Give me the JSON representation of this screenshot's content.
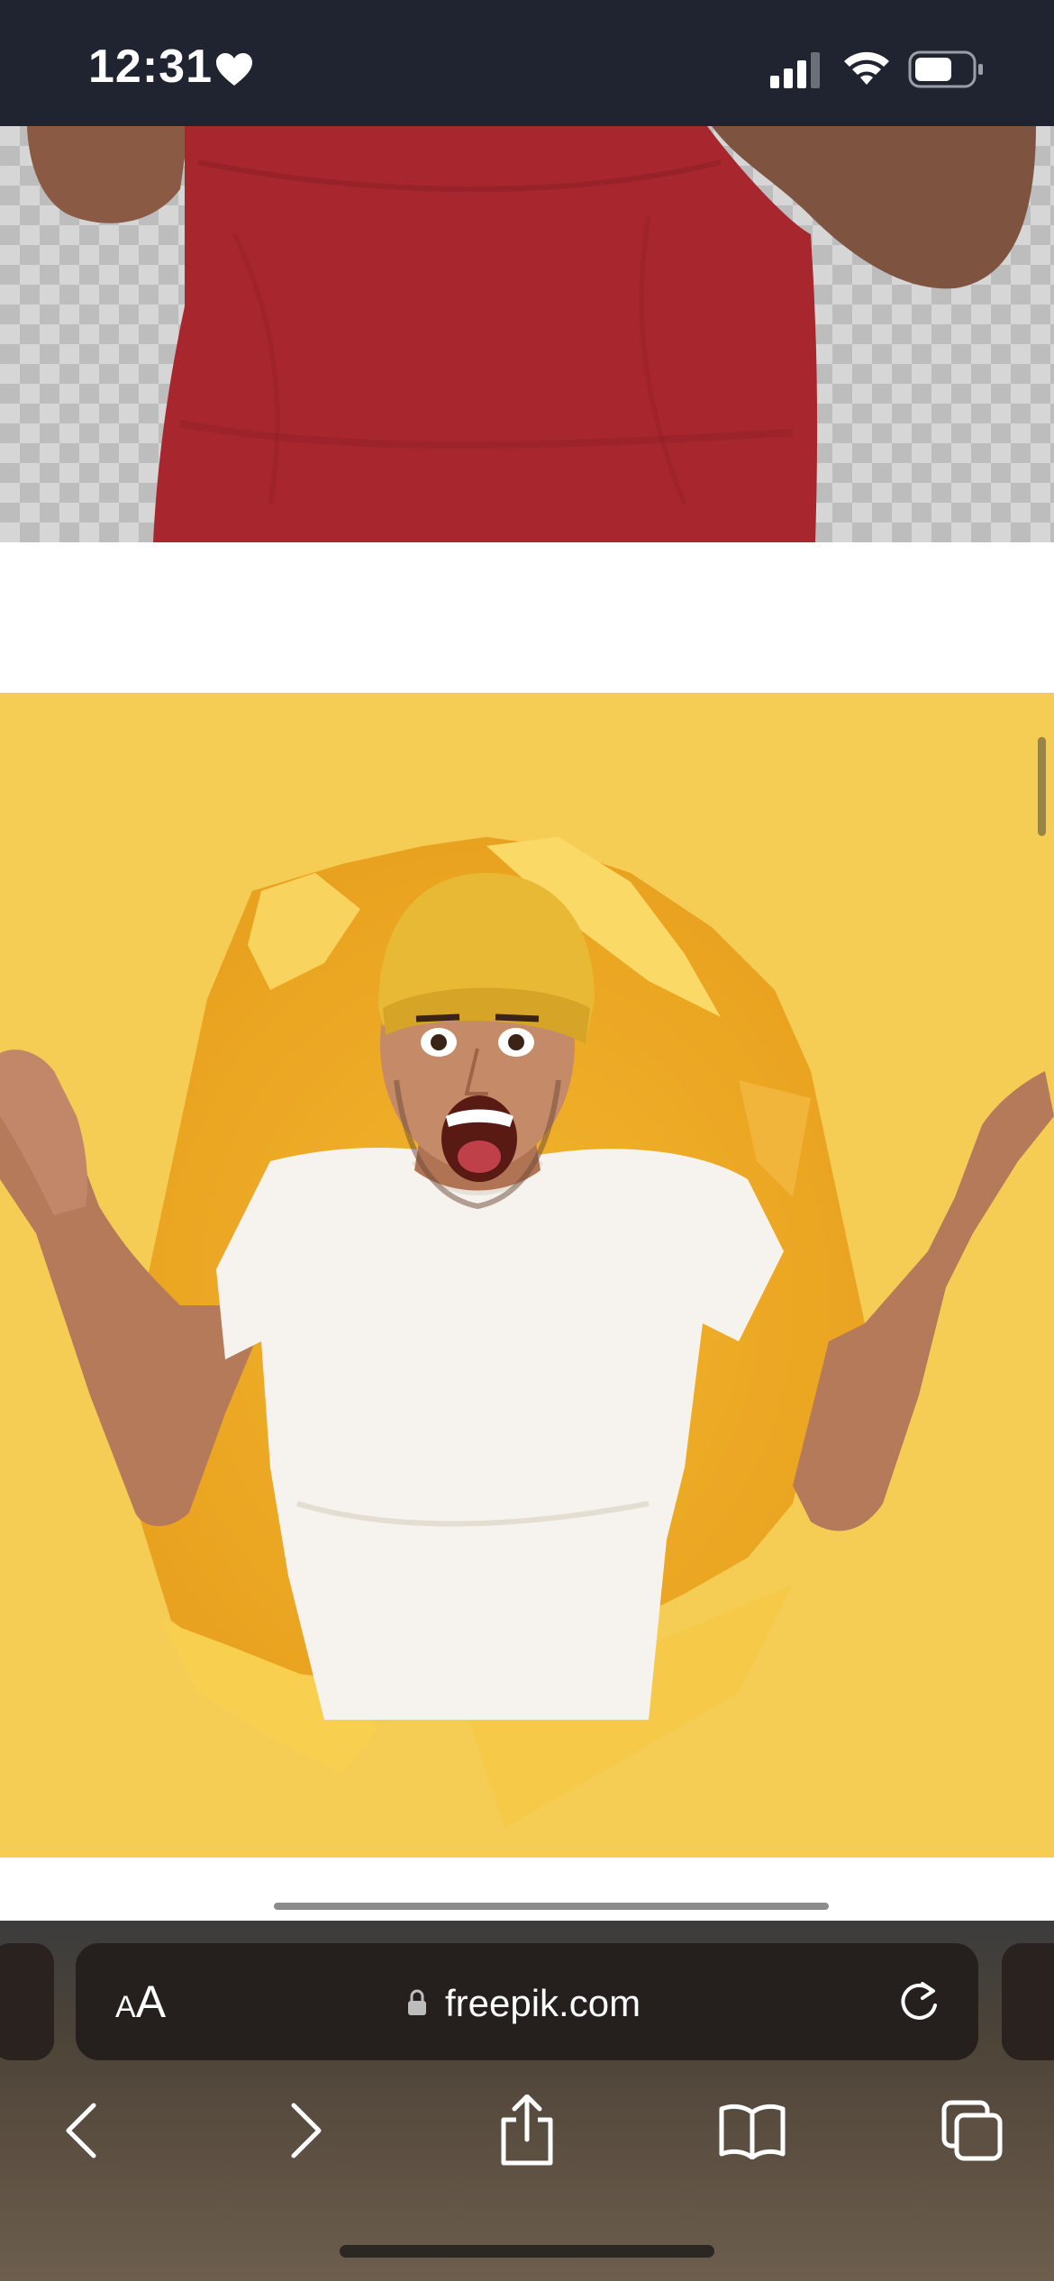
{
  "status_bar": {
    "time": "12:31",
    "icons": [
      "heart-icon",
      "cellular-signal-icon",
      "wifi-icon",
      "battery-icon"
    ]
  },
  "content": {
    "images": [
      {
        "name": "man-red-tshirt-cutout",
        "background": "transparent-checkerboard"
      },
      {
        "name": "excited-man-torn-yellow-paper",
        "background": "#f3c94a"
      }
    ]
  },
  "browser": {
    "text_size_label_small": "A",
    "text_size_label_large": "A",
    "url": "freepik.com",
    "nav_buttons": [
      "back-icon",
      "forward-icon",
      "share-icon",
      "bookmarks-icon",
      "tabs-icon"
    ]
  },
  "colors": {
    "status_bar_bg": "#1f2430",
    "accent_yellow": "#f3c94a",
    "shirt_red": "#a8262d",
    "toolbar_bg": "#4e4438"
  }
}
